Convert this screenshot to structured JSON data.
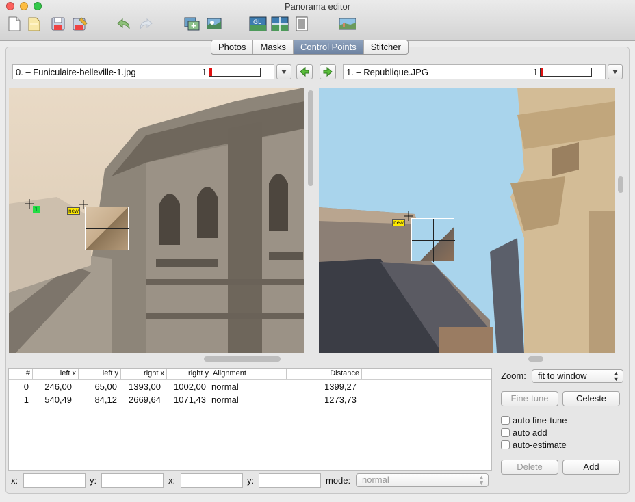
{
  "window": {
    "title": "Panorama editor"
  },
  "toolbar": [
    "new-project-icon",
    "open-project-icon",
    "save-icon",
    "save-as-icon",
    "undo-icon",
    "redo-icon",
    "add-images-icon",
    "add-time-series-icon",
    "gl-preview-icon",
    "fast-preview-icon",
    "batch-icon",
    "panorama-preview-icon"
  ],
  "tabs": [
    {
      "label": "Photos",
      "active": false
    },
    {
      "label": "Masks",
      "active": false
    },
    {
      "label": "Control Points",
      "active": true
    },
    {
      "label": "Stitcher",
      "active": false
    }
  ],
  "left_image": {
    "name": "0. – Funiculaire-belleville-1.jpg",
    "count": "1",
    "meter_fraction": 0.05
  },
  "right_image": {
    "name": "1. – Republique.JPG",
    "count": "1",
    "meter_fraction": 0.05
  },
  "markers": {
    "left_id": "1",
    "new_label": "new"
  },
  "table": {
    "columns": [
      "#",
      "left x",
      "left y",
      "right x",
      "right y",
      "Alignment",
      "Distance"
    ],
    "rows": [
      [
        "0",
        "246,00",
        "65,00",
        "1393,00",
        "1002,00",
        "normal",
        "1399,27"
      ],
      [
        "1",
        "540,49",
        "84,12",
        "2669,64",
        "1071,43",
        "normal",
        "1273,73"
      ]
    ]
  },
  "zoom": {
    "label": "Zoom:",
    "value": "fit to window"
  },
  "buttons": {
    "fine_tune": "Fine-tune",
    "celeste": "Celeste",
    "delete": "Delete",
    "add": "Add"
  },
  "checkboxes": [
    {
      "label": "auto fine-tune",
      "checked": false
    },
    {
      "label": "auto add",
      "checked": false
    },
    {
      "label": "auto-estimate",
      "checked": false
    }
  ],
  "fields": {
    "x1_label": "x:",
    "y1_label": "y:",
    "x2_label": "x:",
    "y2_label": "y:",
    "mode_label": "mode:",
    "mode_value": "normal"
  },
  "colors": {
    "tab_active": "#7388a6",
    "meter_red": "#e01010",
    "sky": "#a9d4ec",
    "marker_yellow": "#ffea00",
    "marker_green": "#22dd44"
  }
}
